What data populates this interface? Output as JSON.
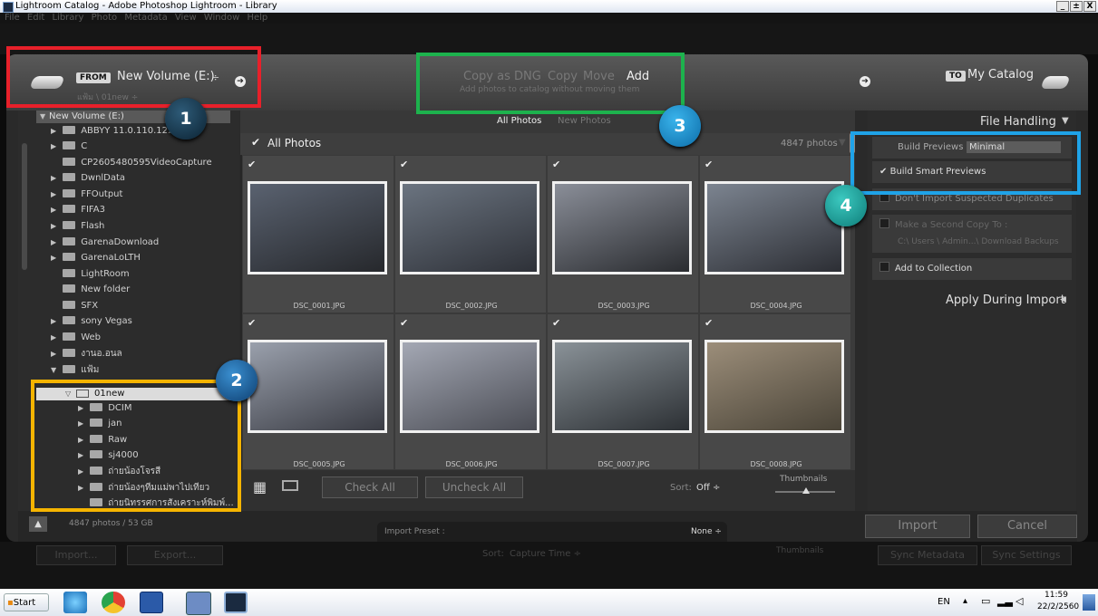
{
  "window": {
    "title": "Lightroom Catalog - Adobe Photoshop Lightroom - Library",
    "app_icon": "Lr",
    "controls": [
      "_",
      "±",
      "X"
    ]
  },
  "menu": [
    "File",
    "Edit",
    "Library",
    "Photo",
    "Metadata",
    "View",
    "Window",
    "Help"
  ],
  "header": {
    "from_badge": "FROM",
    "source": "New Volume (E:)",
    "source_arrow": "÷",
    "path": "แฟ้ม \\ 01new ÷",
    "modes": [
      "Copy as DNG",
      "Copy",
      "Move",
      "Add"
    ],
    "mode_active": "Add",
    "mode_desc": "Add photos to catalog without moving them",
    "to_badge": "TO",
    "destination": "My Catalog"
  },
  "source_panel": {
    "root": "New Volume (E:)",
    "folders": [
      "ABBYY 11.0.110.122 C",
      "C",
      "CP2605480595VideoCapture",
      "DwnlData",
      "FFOutput",
      "FIFA3",
      "Flash",
      "GarenaDownload",
      "GarenaLoLTH",
      "LightRoom",
      "New folder",
      "SFX",
      "sony Vegas",
      "Web",
      "งานอ.อนล",
      "แฟ้ม"
    ],
    "selected": "01new",
    "subfolders": [
      "DCIM",
      "jan",
      "Raw",
      "sj4000",
      "ถ่ายน้องโจรสี",
      "ถ่ายน้องๆทีมแม่พาไปเทียว",
      "ถ่ายนิทรรศการสังเคราะห์พิมพ์..."
    ],
    "footer": "4847 photos / 53 GB"
  },
  "grid": {
    "tabs": [
      "All Photos",
      "New Photos"
    ],
    "title": "All Photos",
    "count": "4847 photos",
    "photos": [
      {
        "name": "DSC_0001.JPG",
        "c1": "#5a6270",
        "c2": "#26282c"
      },
      {
        "name": "DSC_0002.JPG",
        "c1": "#6b7480",
        "c2": "#2e3138"
      },
      {
        "name": "DSC_0003.JPG",
        "c1": "#8a8e98",
        "c2": "#2a2c30"
      },
      {
        "name": "DSC_0004.JPG",
        "c1": "#7c8490",
        "c2": "#2c2e34"
      },
      {
        "name": "DSC_0005.JPG",
        "c1": "#9aa0ac",
        "c2": "#3a3c44"
      },
      {
        "name": "DSC_0006.JPG",
        "c1": "#a4a8b4",
        "c2": "#4a4c54"
      },
      {
        "name": "DSC_0007.JPG",
        "c1": "#8a9298",
        "c2": "#2c3034"
      },
      {
        "name": "DSC_0008.JPG",
        "c1": "#9c8e7a",
        "c2": "#4a4438"
      }
    ],
    "check_all": "Check All",
    "uncheck_all": "Uncheck All",
    "sort_label": "Sort:",
    "sort_value": "Off ÷",
    "thumbnails_label": "Thumbnails"
  },
  "file_handling": {
    "title": "File Handling",
    "build_previews_label": "Build Previews",
    "build_previews_value": "Minimal",
    "build_smart": "Build Smart Previews",
    "dont_import": "Don't Import Suspected Duplicates",
    "second_copy": "Make a Second Copy To :",
    "second_copy_path": "C:\\ Users \\ Admin...\\ Download Backups",
    "add_collection": "Add to Collection",
    "apply_during": "Apply During Import"
  },
  "footer": {
    "import_preset_label": "Import Preset :",
    "import_preset_value": "None ÷",
    "import": "Import",
    "cancel": "Cancel"
  },
  "library_bg": {
    "import": "Import...",
    "export": "Export...",
    "sort": "Sort:",
    "sort_value": "Capture Time ÷",
    "thumbnails": "Thumbnails",
    "sync_metadata": "Sync Metadata",
    "sync_settings": "Sync Settings"
  },
  "callouts": [
    "1",
    "2",
    "3",
    "4"
  ],
  "taskbar": {
    "start": "Start",
    "lang": "EN",
    "time": "11:59",
    "date": "22/2/2560"
  },
  "colors": {
    "callout_red": "#e8202a",
    "callout_yellow": "#f5b400",
    "callout_green": "#1db24d",
    "callout_blue": "#1fa3e8"
  }
}
